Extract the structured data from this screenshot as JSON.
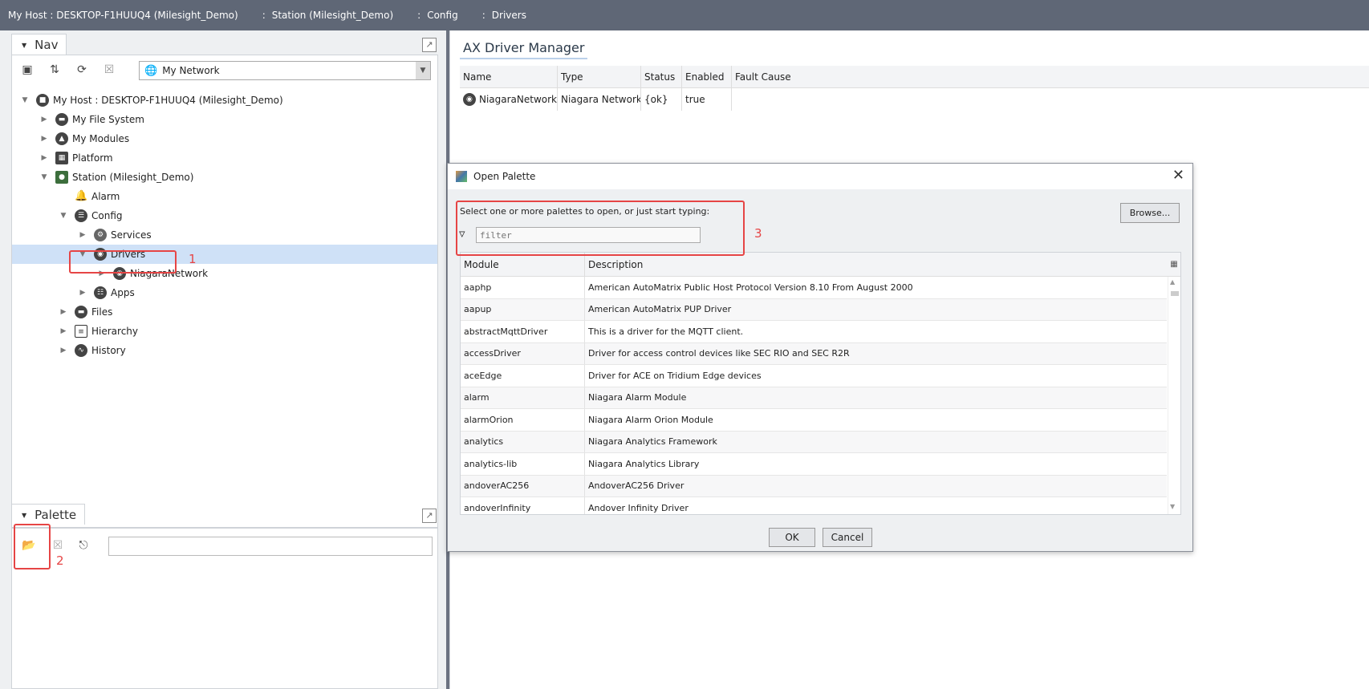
{
  "breadcrumb": [
    "My Host : DESKTOP-F1HUUQ4 (Milesight_Demo)",
    "Station (Milesight_Demo)",
    "Config",
    "Drivers"
  ],
  "breadcrumb_sep": ":",
  "nav": {
    "title": "Nav",
    "network_selector": "My Network",
    "tree": [
      {
        "label": "My Host : DESKTOP-F1HUUQ4 (Milesight_Demo)"
      },
      {
        "label": "My File System"
      },
      {
        "label": "My Modules"
      },
      {
        "label": "Platform"
      },
      {
        "label": "Station (Milesight_Demo)"
      },
      {
        "label": "Alarm"
      },
      {
        "label": "Config"
      },
      {
        "label": "Services"
      },
      {
        "label": "Drivers"
      },
      {
        "label": "NiagaraNetwork"
      },
      {
        "label": "Apps"
      },
      {
        "label": "Files"
      },
      {
        "label": "Hierarchy"
      },
      {
        "label": "History"
      }
    ]
  },
  "palette": {
    "title": "Palette",
    "search_value": ""
  },
  "annotations": {
    "one": "1",
    "two": "2",
    "three": "3"
  },
  "manager": {
    "tab": "AX Driver Manager",
    "columns": [
      "Name",
      "Type",
      "Status",
      "Enabled",
      "Fault Cause"
    ],
    "rows": [
      {
        "name": "NiagaraNetwork",
        "type": "Niagara Network",
        "status": "{ok}",
        "enabled": "true",
        "fault": ""
      }
    ]
  },
  "dialog": {
    "title": "Open Palette",
    "prompt": "Select one or more palettes to open, or just start typing:",
    "filter_placeholder": "filter",
    "browse_label": "Browse...",
    "columns": [
      "Module",
      "Description"
    ],
    "rows": [
      {
        "module": "aaphp",
        "description": "American AutoMatrix Public Host Protocol Version 8.10 From August 2000"
      },
      {
        "module": "aapup",
        "description": "American AutoMatrix PUP Driver"
      },
      {
        "module": "abstractMqttDriver",
        "description": "This is a driver for the MQTT client."
      },
      {
        "module": "accessDriver",
        "description": "Driver for access control devices like SEC RIO and SEC R2R"
      },
      {
        "module": "aceEdge",
        "description": "Driver for ACE on Tridium Edge devices"
      },
      {
        "module": "alarm",
        "description": "Niagara Alarm Module"
      },
      {
        "module": "alarmOrion",
        "description": "Niagara Alarm Orion Module"
      },
      {
        "module": "analytics",
        "description": "Niagara Analytics Framework"
      },
      {
        "module": "analytics-lib",
        "description": "Niagara Analytics Library"
      },
      {
        "module": "andoverAC256",
        "description": "AndoverAC256 Driver"
      },
      {
        "module": "andoverInfinity",
        "description": "Andover Infinity Driver"
      }
    ],
    "ok_label": "OK",
    "cancel_label": "Cancel"
  },
  "colors": {
    "selection": "#cfe1f7",
    "annotation": "#e64545",
    "titlebar": "#5f6776"
  }
}
